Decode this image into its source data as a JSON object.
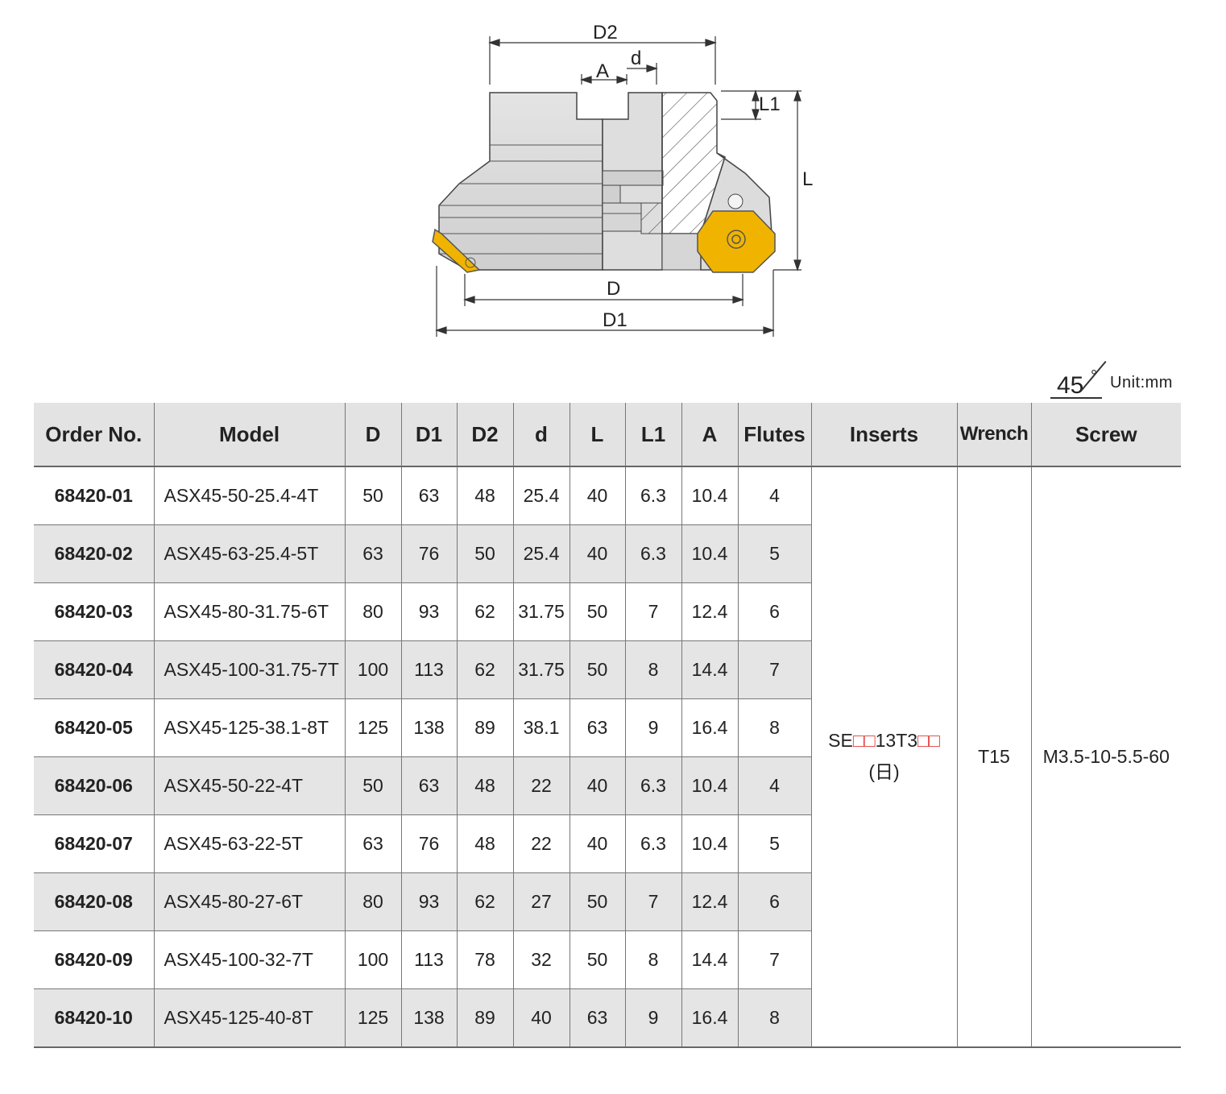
{
  "drawing": {
    "dimension_labels": {
      "D2": "D2",
      "d": "d",
      "A": "A",
      "L1": "L1",
      "L": "L",
      "D": "D",
      "D1": "D1"
    },
    "insert_color": "#f0b400"
  },
  "badge": {
    "angle": "45",
    "degree": "°",
    "unit": "Unit:mm"
  },
  "table": {
    "headers": [
      "Order No.",
      "Model",
      "D",
      "D1",
      "D2",
      "d",
      "L",
      "L1",
      "A",
      "Flutes",
      "Inserts",
      "Wrench",
      "Screw"
    ],
    "rows": [
      {
        "order": "68420-01",
        "model": "ASX45-50-25.4-4T",
        "D": "50",
        "D1": "63",
        "D2": "48",
        "d": "25.4",
        "L": "40",
        "L1": "6.3",
        "A": "10.4",
        "flutes": "4"
      },
      {
        "order": "68420-02",
        "model": "ASX45-63-25.4-5T",
        "D": "63",
        "D1": "76",
        "D2": "50",
        "d": "25.4",
        "L": "40",
        "L1": "6.3",
        "A": "10.4",
        "flutes": "5"
      },
      {
        "order": "68420-03",
        "model": "ASX45-80-31.75-6T",
        "D": "80",
        "D1": "93",
        "D2": "62",
        "d": "31.75",
        "L": "50",
        "L1": "7",
        "A": "12.4",
        "flutes": "6"
      },
      {
        "order": "68420-04",
        "model": "ASX45-100-31.75-7T",
        "D": "100",
        "D1": "113",
        "D2": "62",
        "d": "31.75",
        "L": "50",
        "L1": "8",
        "A": "14.4",
        "flutes": "7"
      },
      {
        "order": "68420-05",
        "model": "ASX45-125-38.1-8T",
        "D": "125",
        "D1": "138",
        "D2": "89",
        "d": "38.1",
        "L": "63",
        "L1": "9",
        "A": "16.4",
        "flutes": "8"
      },
      {
        "order": "68420-06",
        "model": "ASX45-50-22-4T",
        "D": "50",
        "D1": "63",
        "D2": "48",
        "d": "22",
        "L": "40",
        "L1": "6.3",
        "A": "10.4",
        "flutes": "4"
      },
      {
        "order": "68420-07",
        "model": "ASX45-63-22-5T",
        "D": "63",
        "D1": "76",
        "D2": "48",
        "d": "22",
        "L": "40",
        "L1": "6.3",
        "A": "10.4",
        "flutes": "5"
      },
      {
        "order": "68420-08",
        "model": "ASX45-80-27-6T",
        "D": "80",
        "D1": "93",
        "D2": "62",
        "d": "27",
        "L": "50",
        "L1": "7",
        "A": "12.4",
        "flutes": "6"
      },
      {
        "order": "68420-09",
        "model": "ASX45-100-32-7T",
        "D": "100",
        "D1": "113",
        "D2": "78",
        "d": "32",
        "L": "50",
        "L1": "8",
        "A": "14.4",
        "flutes": "7"
      },
      {
        "order": "68420-10",
        "model": "ASX45-125-40-8T",
        "D": "125",
        "D1": "138",
        "D2": "89",
        "d": "40",
        "L": "63",
        "L1": "9",
        "A": "16.4",
        "flutes": "8"
      }
    ],
    "inserts": {
      "prefix": "SE",
      "boxes1": "□□",
      "middle": "13T3",
      "boxes2": "□□",
      "note": "(日)"
    },
    "wrench": "T15",
    "screw": "M3.5-10-5.5-60"
  }
}
